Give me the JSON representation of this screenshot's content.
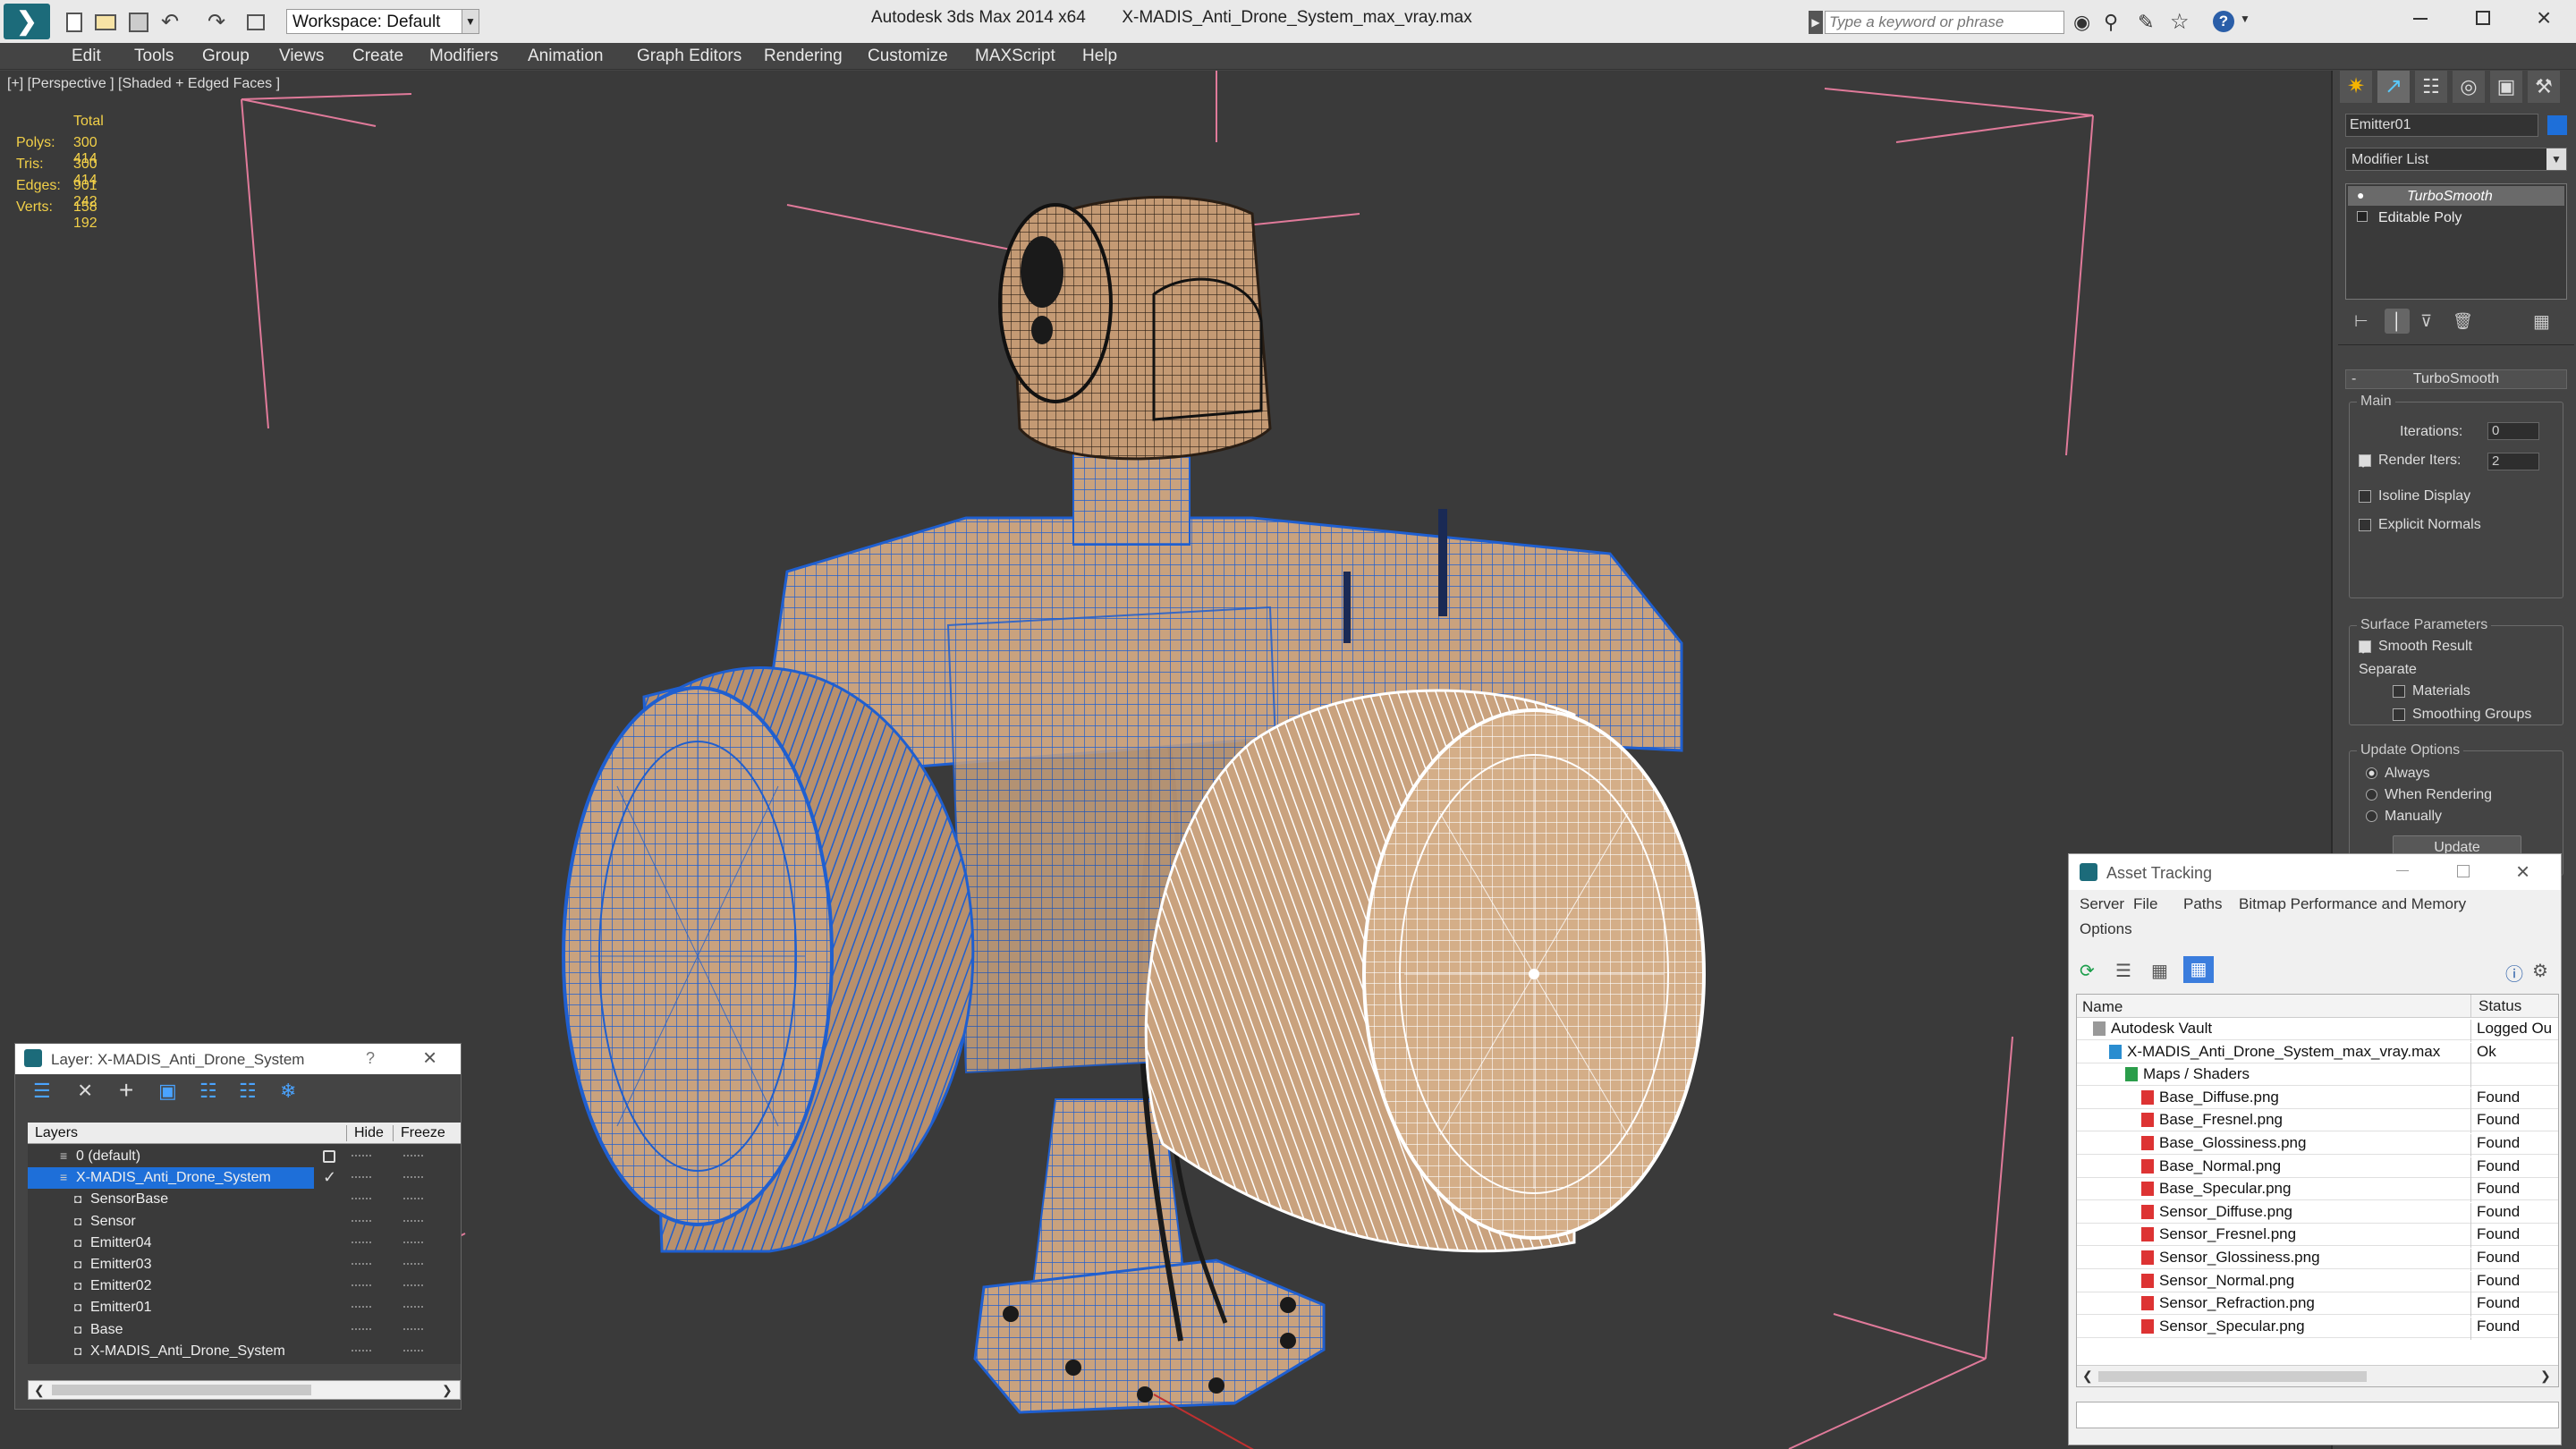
{
  "app": {
    "title": "Autodesk 3ds Max  2014 x64",
    "file": "X-MADIS_Anti_Drone_System_max_vray.max",
    "workspace": "Workspace: Default",
    "search_placeholder": "Type a keyword or phrase"
  },
  "menu": [
    "Edit",
    "Tools",
    "Group",
    "Views",
    "Create",
    "Modifiers",
    "Animation",
    "Graph Editors",
    "Rendering",
    "Customize",
    "MAXScript",
    "Help"
  ],
  "viewport": {
    "label": "[+] [Perspective ] [Shaded + Edged Faces ]",
    "stats_header": "Total",
    "stats": [
      {
        "k": "Polys:",
        "v": "300 414"
      },
      {
        "k": "Tris:",
        "v": "300 414"
      },
      {
        "k": "Edges:",
        "v": "901 242"
      },
      {
        "k": "Verts:",
        "v": "158 192"
      }
    ]
  },
  "cmd": {
    "object_name": "Emitter01",
    "modifier_list": "Modifier List",
    "stack": [
      "TurboSmooth",
      "Editable Poly"
    ],
    "rollout_title": "TurboSmooth",
    "main_group": "Main",
    "iterations_label": "Iterations:",
    "iterations_value": "0",
    "render_iters_label": "Render Iters:",
    "render_iters_value": "2",
    "isoline_label": "Isoline Display",
    "explicit_label": "Explicit Normals",
    "surface_group": "Surface Parameters",
    "smooth_result_label": "Smooth Result",
    "separate_label": "Separate",
    "materials_label": "Materials",
    "smoothing_groups_label": "Smoothing Groups",
    "update_group": "Update Options",
    "always_label": "Always",
    "when_rendering_label": "When Rendering",
    "manually_label": "Manually",
    "update_button": "Update"
  },
  "layer_window": {
    "title": "Layer: X-MADIS_Anti_Drone_System",
    "help": "?",
    "col_layers": "Layers",
    "col_hide": "Hide",
    "col_freeze": "Freeze",
    "rows": [
      {
        "name": "0 (default)",
        "indent": 0
      },
      {
        "name": "X-MADIS_Anti_Drone_System",
        "indent": 0
      },
      {
        "name": "SensorBase",
        "indent": 1
      },
      {
        "name": "Sensor",
        "indent": 1
      },
      {
        "name": "Emitter04",
        "indent": 1
      },
      {
        "name": "Emitter03",
        "indent": 1
      },
      {
        "name": "Emitter02",
        "indent": 1
      },
      {
        "name": "Emitter01",
        "indent": 1
      },
      {
        "name": "Base",
        "indent": 1
      },
      {
        "name": "X-MADIS_Anti_Drone_System",
        "indent": 1
      }
    ]
  },
  "asset_window": {
    "title": "Asset Tracking",
    "menus": [
      "Server",
      "File",
      "Paths",
      "Bitmap Performance and Memory"
    ],
    "menu2": "Options",
    "col_name": "Name",
    "col_status": "Status",
    "rows": [
      {
        "name": "Autodesk Vault",
        "status": "Logged Ou",
        "indent": 0
      },
      {
        "name": "X-MADIS_Anti_Drone_System_max_vray.max",
        "status": "Ok",
        "indent": 1
      },
      {
        "name": "Maps / Shaders",
        "status": "",
        "indent": 2
      },
      {
        "name": "Base_Diffuse.png",
        "status": "Found",
        "indent": 3
      },
      {
        "name": "Base_Fresnel.png",
        "status": "Found",
        "indent": 3
      },
      {
        "name": "Base_Glossiness.png",
        "status": "Found",
        "indent": 3
      },
      {
        "name": "Base_Normal.png",
        "status": "Found",
        "indent": 3
      },
      {
        "name": "Base_Specular.png",
        "status": "Found",
        "indent": 3
      },
      {
        "name": "Sensor_Diffuse.png",
        "status": "Found",
        "indent": 3
      },
      {
        "name": "Sensor_Fresnel.png",
        "status": "Found",
        "indent": 3
      },
      {
        "name": "Sensor_Glossiness.png",
        "status": "Found",
        "indent": 3
      },
      {
        "name": "Sensor_Normal.png",
        "status": "Found",
        "indent": 3
      },
      {
        "name": "Sensor_Refraction.png",
        "status": "Found",
        "indent": 3
      },
      {
        "name": "Sensor_Specular.png",
        "status": "Found",
        "indent": 3
      }
    ]
  },
  "colors": {
    "accent": "#1e6fd9",
    "wire": "#1f5fd0",
    "model": "#c9a27e",
    "selected_wire": "#ffffff"
  }
}
